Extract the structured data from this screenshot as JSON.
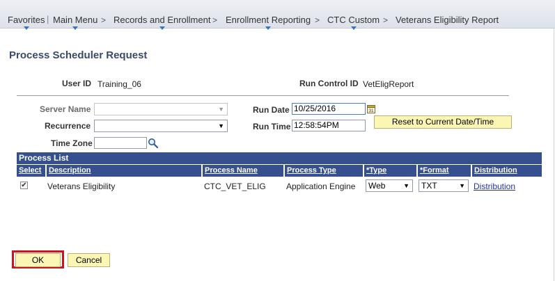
{
  "breadcrumb": {
    "items": [
      "Favorites",
      "Main Menu",
      "Records and Enrollment",
      "Enrollment Reporting",
      "CTC Custom",
      "Veterans Eligibility Report"
    ],
    "separator": ">",
    "divider": "|"
  },
  "page": {
    "title": "Process Scheduler Request"
  },
  "user": {
    "label": "User ID",
    "value": "Training_06"
  },
  "run_control": {
    "label": "Run Control ID",
    "value": "VetEligReport"
  },
  "server": {
    "label": "Server Name",
    "value": ""
  },
  "recurrence": {
    "label": "Recurrence",
    "value": ""
  },
  "time_zone": {
    "label": "Time Zone",
    "value": ""
  },
  "run_date": {
    "label": "Run Date",
    "value": "10/25/2016",
    "calendar_glyph": "31"
  },
  "run_time": {
    "label": "Run Time",
    "value": "12:58:54PM"
  },
  "reset_button": {
    "label": "Reset to Current Date/Time"
  },
  "process_list": {
    "title": "Process List",
    "columns": [
      "Select",
      "Description",
      "Process Name",
      "Process Type",
      "*Type",
      "*Format",
      "Distribution"
    ],
    "rows": [
      {
        "selected": true,
        "description": "Veterans Eligibility",
        "process_name": "CTC_VET_ELIG",
        "process_type": "Application Engine",
        "type": "Web",
        "format": "TXT",
        "distribution": "Distribution"
      }
    ]
  },
  "buttons": {
    "ok": "OK",
    "cancel": "Cancel"
  },
  "check_mark": "✔",
  "dropdown_arrow": "▼",
  "colors": {
    "grid_header": "#36508f",
    "button_bg": "#fbf6b4",
    "highlight": "#d0121b",
    "title": "#3a4a6b",
    "link": "#2233aa"
  },
  "icons": {
    "search": "search-icon",
    "calendar": "calendar-icon"
  }
}
